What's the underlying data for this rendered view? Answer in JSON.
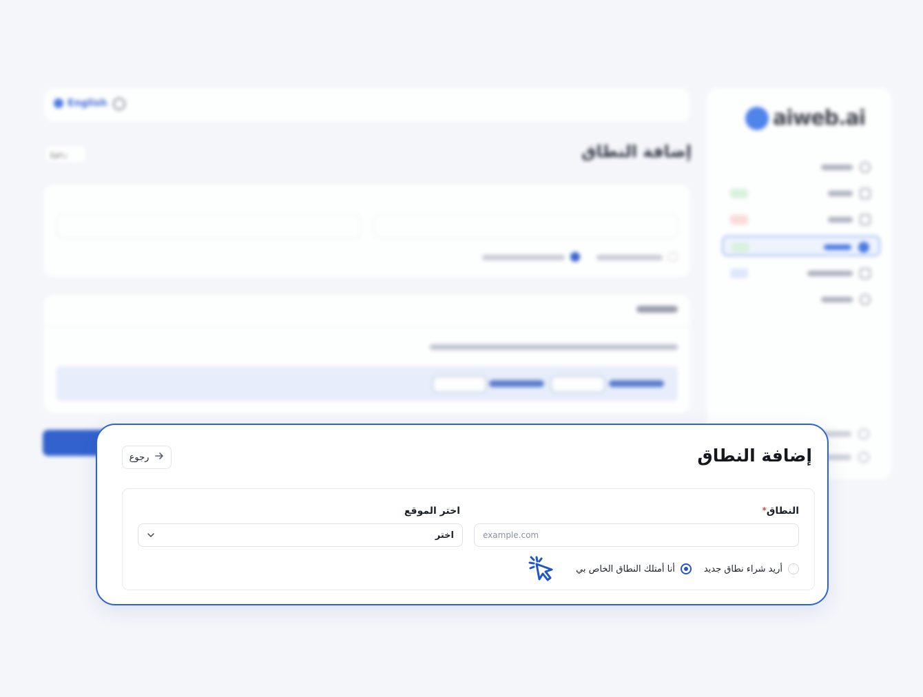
{
  "background": {
    "language_label": "English",
    "back_label": "رجوع",
    "title": "إضافة النطاق",
    "sidebar": {
      "brand": "aiweb.ai"
    }
  },
  "panel": {
    "title": "إضافة النطاق",
    "back_button": "رجوع",
    "domain_field": {
      "label": "النطاق",
      "required_mark": "*",
      "placeholder": "example.com",
      "value": ""
    },
    "site_field": {
      "label": "اختر الموقع",
      "selected": "اختر"
    },
    "radio_options": [
      {
        "label": "أريد شراء نطاق جديد",
        "checked": false
      },
      {
        "label": "أنا أمتلك النطاق الخاص بي",
        "checked": true
      }
    ]
  },
  "colors": {
    "accent": "#2b62d4",
    "primary_blue": "#2753c9",
    "required": "#e0443a",
    "page_bg": "#f4f6fa"
  },
  "icons": {
    "back": "arrow-right-icon",
    "select": "chevron-down-icon",
    "cursor": "click-cursor-icon"
  }
}
